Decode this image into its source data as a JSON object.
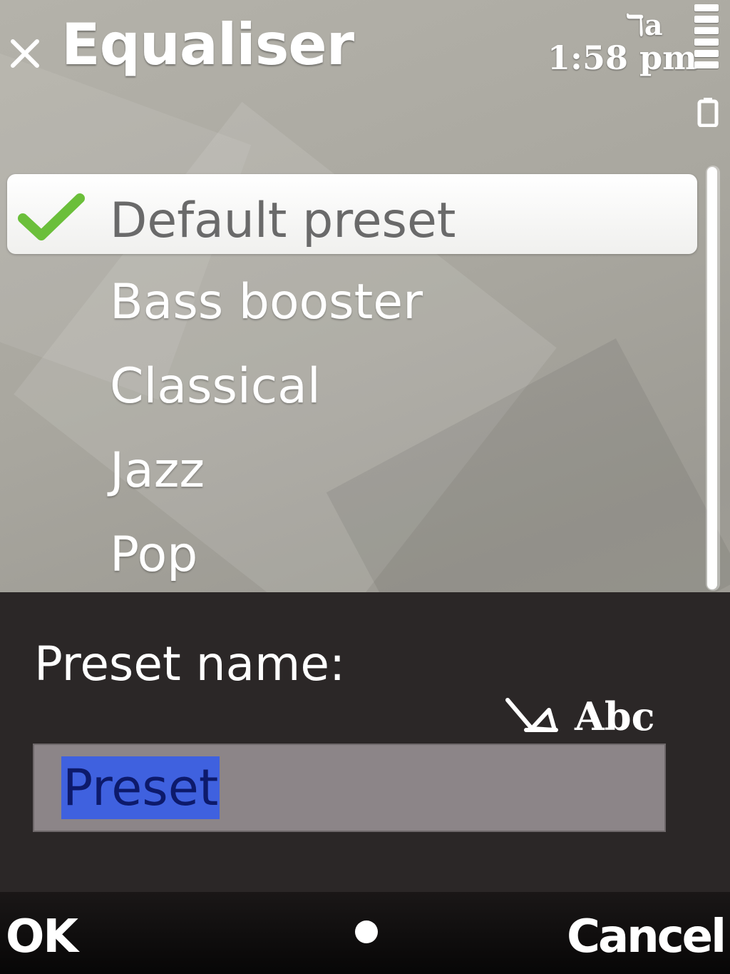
{
  "header": {
    "title": "Equaliser",
    "network_indicator": "ℸa",
    "time": "1:58 pm",
    "signal_level": 6
  },
  "presets": {
    "items": [
      {
        "label": "Default preset",
        "selected": true
      },
      {
        "label": "Bass booster",
        "selected": false
      },
      {
        "label": "Classical",
        "selected": false
      },
      {
        "label": "Jazz",
        "selected": false
      },
      {
        "label": "Pop",
        "selected": false
      }
    ]
  },
  "dialog": {
    "label": "Preset name:",
    "input_mode": "Abc",
    "input_value": "Preset"
  },
  "softkeys": {
    "left": "OK",
    "right": "Cancel"
  },
  "colors": {
    "dialog_bg": "#2b2727",
    "input_bg": "#8c8588",
    "text_highlight": "#3f61df",
    "check_green": "#6bbf3a"
  },
  "icons": [
    "close-icon",
    "check-icon",
    "signal-icon",
    "battery-icon",
    "input-mode-icon"
  ]
}
